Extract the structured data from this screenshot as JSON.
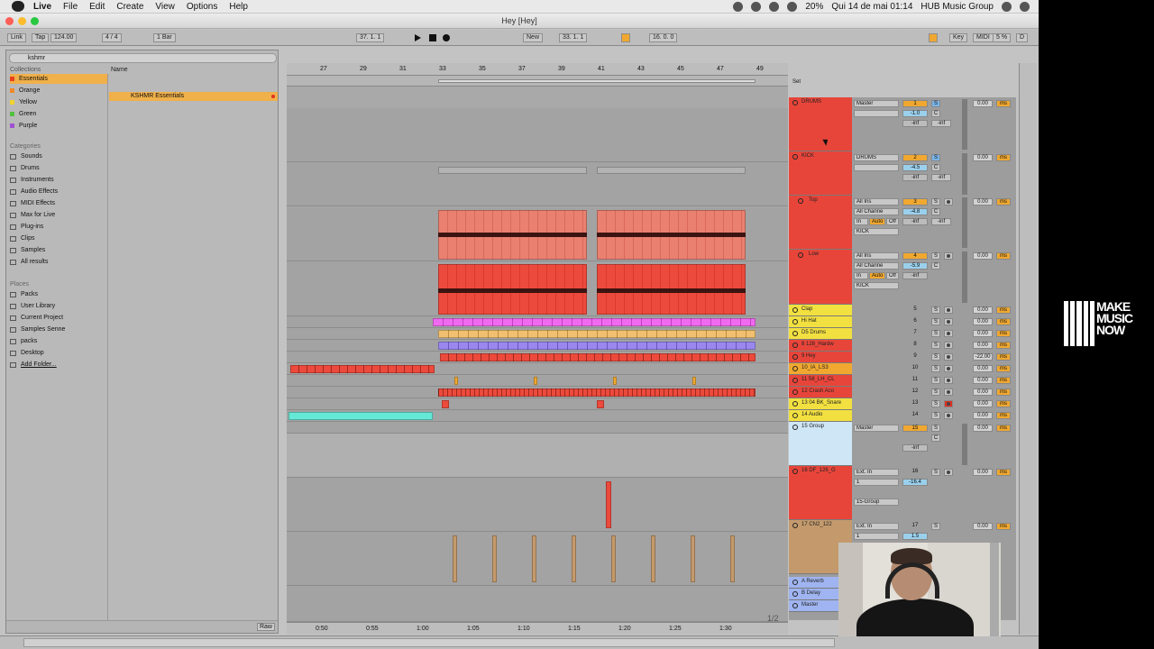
{
  "menubar": {
    "app": "Live",
    "items": [
      "File",
      "Edit",
      "Create",
      "View",
      "Options",
      "Help"
    ],
    "battery": "20%",
    "datetime": "Qui 14 de mai  01:14",
    "user": "HUB Music Group"
  },
  "window": {
    "title": "Hey  [Hey]"
  },
  "control": {
    "link": "Link",
    "tap": "Tap",
    "bpm": "124.00",
    "sig": "4 / 4",
    "quant": "1 Bar",
    "pos": "37.   1.   1",
    "new": "New",
    "loop_start": "33.   1.   1",
    "loop_len": "16.   0.   0",
    "key": "Key",
    "midi": "MIDI",
    "cpu": "5 %",
    "d": "D"
  },
  "browser": {
    "search": "kshmr",
    "collections_label": "Collections",
    "collections": [
      {
        "label": "Essentials",
        "color": "#e8401c"
      },
      {
        "label": "Orange",
        "color": "#f08a24"
      },
      {
        "label": "Yellow",
        "color": "#f2d230"
      },
      {
        "label": "Green",
        "color": "#52c040"
      },
      {
        "label": "Purple",
        "color": "#a050d0"
      }
    ],
    "categories_label": "Categories",
    "categories": [
      "Sounds",
      "Drums",
      "Instruments",
      "Audio Effects",
      "MIDI Effects",
      "Max for Live",
      "Plug-ins",
      "Clips",
      "Samples",
      "All results"
    ],
    "places_label": "Places",
    "places": [
      "Packs",
      "User Library",
      "Current Project",
      "Samples Senne",
      "packs",
      "Desktop",
      "Add Folder..."
    ],
    "name_header": "Name",
    "result": "KSHMR Essentials",
    "raw": "Raw"
  },
  "ruler": {
    "bars": [
      "27",
      "29",
      "31",
      "33",
      "35",
      "37",
      "39",
      "41",
      "43",
      "45",
      "47",
      "49"
    ],
    "times": [
      "0:50",
      "0:55",
      "1:00",
      "1:05",
      "1:10",
      "1:15",
      "1:20",
      "1:25",
      "1:30"
    ]
  },
  "set_label": "Set",
  "pager": "1/2",
  "tracks": [
    {
      "name": "DRUMS",
      "color": "#e8453a",
      "route": "Master",
      "num": "1",
      "vol": "-1.0",
      "db": "0.00",
      "solo_on": true
    },
    {
      "name": "KICK",
      "color": "#e8453a",
      "route": "DRUMS",
      "num": "2",
      "vol": "-4.5",
      "db": "0.00",
      "solo_on": true
    },
    {
      "name": "Top",
      "color": "#e8453a",
      "route": "All Ins",
      "route2": "All Channe",
      "route3": "KICK",
      "num": "3",
      "vol": "-4.8",
      "db": "0.00"
    },
    {
      "name": "Low",
      "color": "#e8453a",
      "route": "All Ins",
      "route2": "All Channe",
      "route3": "KICK",
      "num": "4",
      "vol": "-5.9",
      "db": "0.00"
    },
    {
      "name": "Clap",
      "color": "#f2e040",
      "num": "5",
      "db": "0.00"
    },
    {
      "name": "Hi Hat",
      "color": "#f2e040",
      "num": "6",
      "db": "0.00"
    },
    {
      "name": "D5 Drums",
      "color": "#f2e040",
      "num": "7",
      "db": "0.00"
    },
    {
      "name": "8 128_Hardw",
      "color": "#e8453a",
      "num": "8",
      "db": "0.00"
    },
    {
      "name": "9 Hey",
      "color": "#e8453a",
      "num": "9",
      "db": "-22.00"
    },
    {
      "name": "10_IA_LS3",
      "color": "#f0a830",
      "num": "10",
      "db": "0.00"
    },
    {
      "name": "11 58_LH_CL",
      "color": "#e8453a",
      "num": "11",
      "db": "0.00"
    },
    {
      "name": "12 Crash Aco",
      "color": "#e8453a",
      "num": "12",
      "db": "0.00"
    },
    {
      "name": "13 04 BK_Snare",
      "color": "#f2e040",
      "num": "13",
      "db": "0.00",
      "arm_on": true
    },
    {
      "name": "14 Audio",
      "color": "#f2e040",
      "num": "14",
      "db": "0.00"
    },
    {
      "name": "15 Group",
      "color": "#cfe6f6",
      "route": "Master",
      "num": "15",
      "db": "0.00"
    },
    {
      "name": "16 DF_126_G",
      "color": "#e8453a",
      "route": "Ext. In",
      "route2": "1",
      "route3": "15-Group",
      "num": "16",
      "vol": "-16.4",
      "db": "0.00"
    },
    {
      "name": "17 CN2_122",
      "color": "#c49a6c",
      "route": "Ext. In",
      "route2": "1",
      "num": "17",
      "vol": "1.5",
      "db": "0.00"
    },
    {
      "name": "A Reverb",
      "color": "#9fb4f0"
    },
    {
      "name": "B Delay",
      "color": "#9fb4f0"
    },
    {
      "name": "Master",
      "color": "#9fb4f0"
    }
  ],
  "logo": {
    "line1": "MAKE",
    "line2": "MUSIC",
    "line3": "NOW"
  },
  "lanes": {
    "drums": "DRUMS",
    "kick": "KICK",
    "top": "Top",
    "low": "Low",
    "clap": "Clap",
    "hihat": "Hi Hat",
    "d5": "D5 Drums",
    "hardw": "8 128_Hardw",
    "hey": "9 Hey",
    "ia": "10_IA_LS3",
    "lh": "11 58_LH_CL",
    "crash": "12 Crash Aco",
    "snare": "13 04 BK_Snare",
    "group": "15 Group",
    "df": "16 DF_126_G",
    "cn2": "17 CN2_122"
  },
  "fields": {
    "minf": "-inf",
    "c": "C",
    "in": "In",
    "auto": "Auto",
    "off": "Off",
    "s": "S",
    "ms": "ms"
  }
}
